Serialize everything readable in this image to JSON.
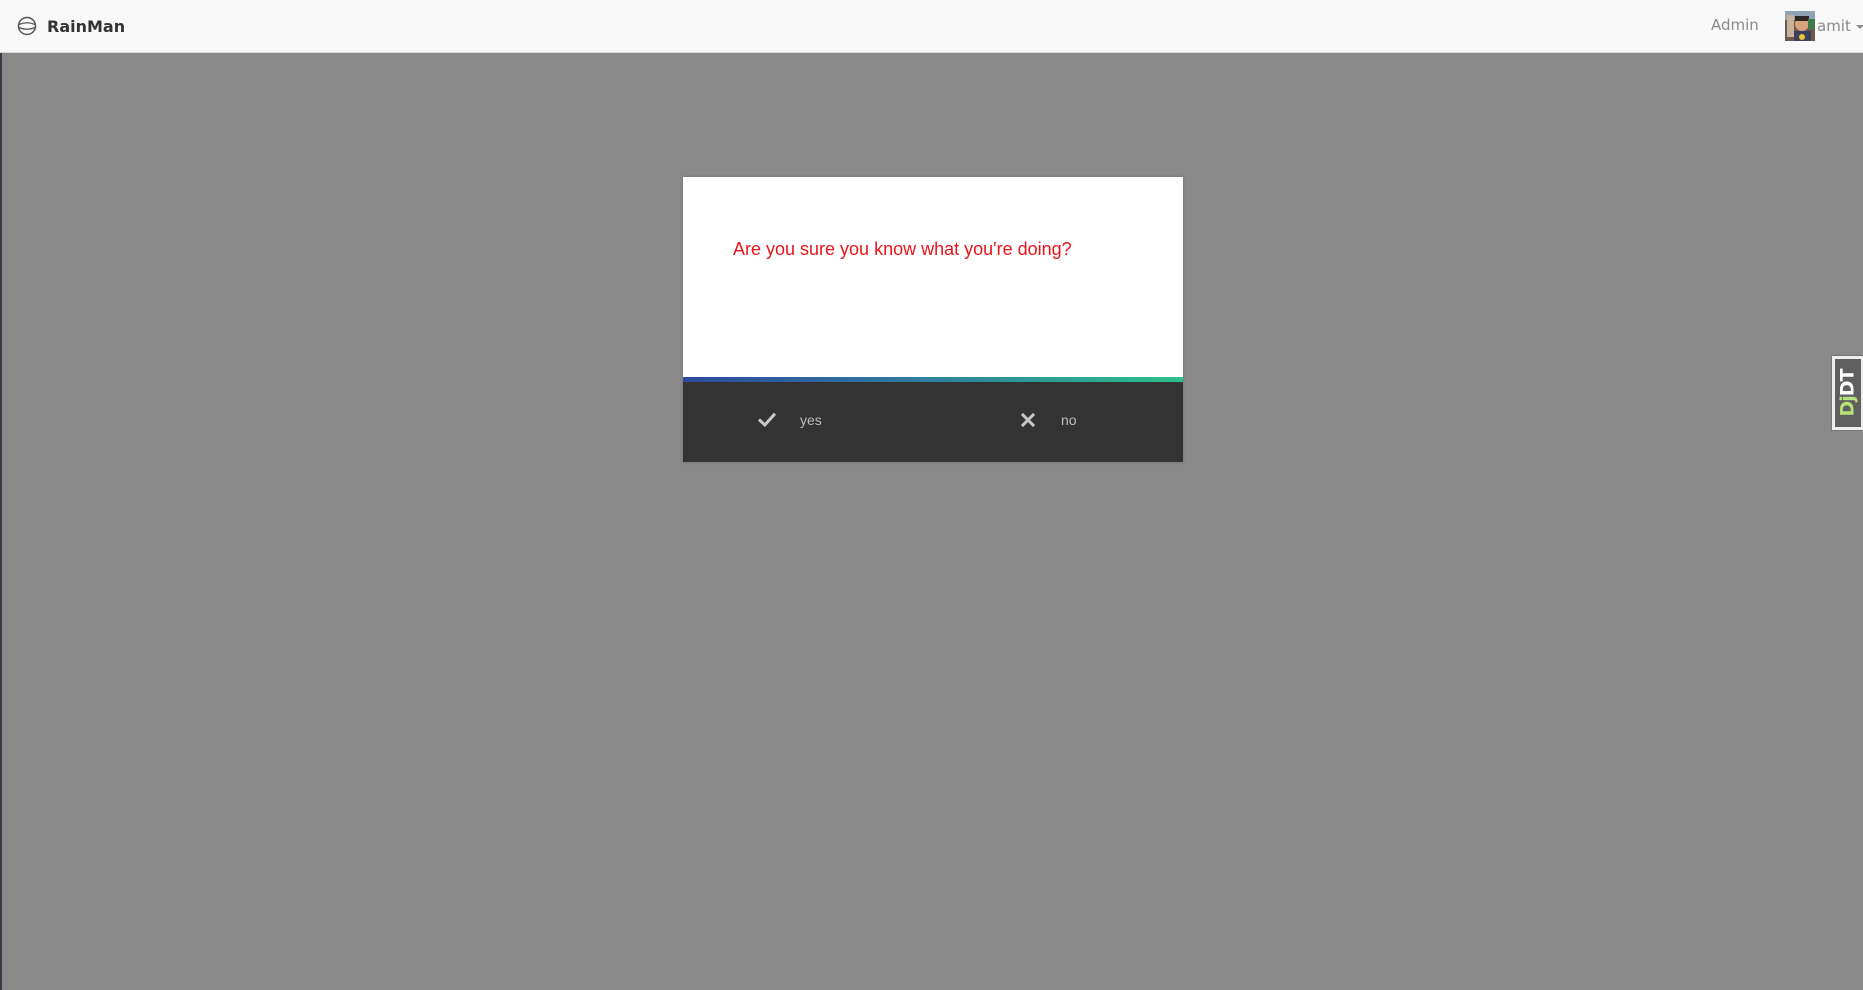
{
  "navbar": {
    "brand_label": "RainMan",
    "brand_icon": "globe-icon",
    "admin_link": "Admin",
    "user_name": "amit",
    "user_avatar": "user-avatar"
  },
  "dialog": {
    "message": "Are you sure you know what you're doing?",
    "yes_label": "yes",
    "yes_icon": "check-icon",
    "no_label": "no",
    "no_icon": "close-icon",
    "colors": {
      "message": "#e8141a",
      "footer": "#333333",
      "stripe_start": "#2c4a9e",
      "stripe_end": "#2dc08a"
    }
  },
  "debug_toolbar": {
    "handle_dj": "Dj",
    "handle_dt": "DT"
  },
  "colors": {
    "overlay": "#898989",
    "navbar": "#f8f8f8"
  }
}
